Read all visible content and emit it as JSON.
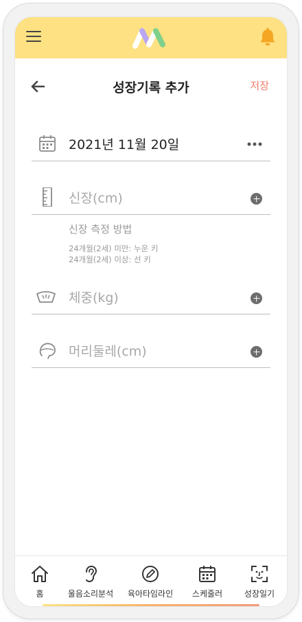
{
  "header": {
    "title": "성장기록 추가",
    "save_label": "저장"
  },
  "form": {
    "date_value": "2021년 11월 20일",
    "height_placeholder": "신장(cm)",
    "weight_placeholder": "체중(kg)",
    "head_placeholder": "머리둘레(cm)"
  },
  "guide": {
    "title": "신장 측정 방법",
    "line1": "24개월(2세) 미만: 누운 키",
    "line2": "24개월(2세) 이상: 선 키"
  },
  "nav": {
    "items": [
      {
        "label": "홈",
        "icon": "home-icon"
      },
      {
        "label": "울음소리분석",
        "icon": "ear-icon"
      },
      {
        "label": "육아타임라인",
        "icon": "pencil-icon"
      },
      {
        "label": "스케줄러",
        "icon": "calendar-icon"
      },
      {
        "label": "성장일기",
        "icon": "face-scan-icon"
      }
    ]
  },
  "colors": {
    "app_bar": "#fde182",
    "accent": "#f07b6a",
    "bell": "#f5a623"
  }
}
